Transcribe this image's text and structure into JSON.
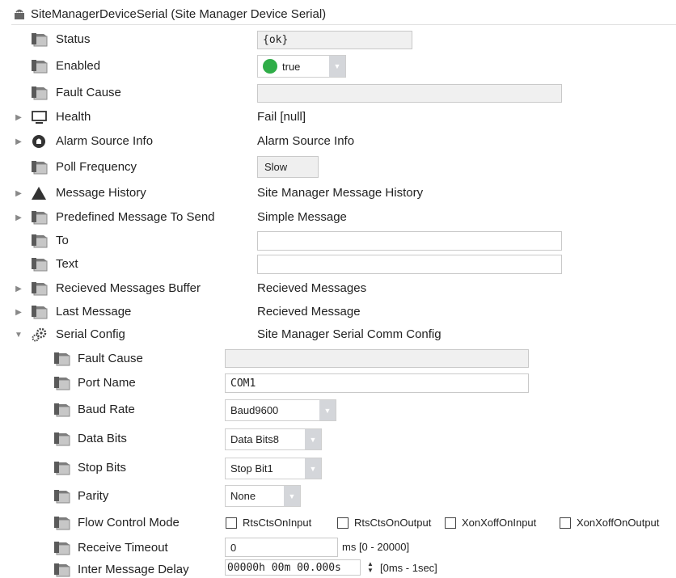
{
  "header": {
    "title": "SiteManagerDeviceSerial  (Site Manager Device Serial)"
  },
  "rows": {
    "status": {
      "label": "Status",
      "value": "{ok}"
    },
    "enabled": {
      "label": "Enabled",
      "value": "true"
    },
    "fault_cause": {
      "label": "Fault Cause",
      "value": ""
    },
    "health": {
      "label": "Health",
      "value": "Fail [null]"
    },
    "alarm_source": {
      "label": "Alarm Source Info",
      "value": "Alarm Source Info"
    },
    "poll_frequency": {
      "label": "Poll Frequency",
      "value": "Slow"
    },
    "message_history": {
      "label": "Message History",
      "value": "Site Manager Message History"
    },
    "predefined_message": {
      "label": "Predefined Message To Send",
      "value": "Simple Message"
    },
    "to": {
      "label": "To",
      "value": ""
    },
    "text": {
      "label": "Text",
      "value": ""
    },
    "received_buffer": {
      "label": "Recieved Messages Buffer",
      "value": "Recieved Messages"
    },
    "last_message": {
      "label": "Last Message",
      "value": "Recieved Message"
    },
    "serial_config": {
      "label": "Serial Config",
      "value": "Site Manager Serial Comm Config"
    }
  },
  "serial": {
    "fault_cause": {
      "label": "Fault Cause",
      "value": ""
    },
    "port_name": {
      "label": "Port Name",
      "value": "COM1"
    },
    "baud_rate": {
      "label": "Baud Rate",
      "value": "Baud9600"
    },
    "data_bits": {
      "label": "Data Bits",
      "value": "Data Bits8"
    },
    "stop_bits": {
      "label": "Stop Bits",
      "value": "Stop Bit1"
    },
    "parity": {
      "label": "Parity",
      "value": "None"
    },
    "flow_control": {
      "label": "Flow Control Mode",
      "options": [
        "RtsCtsOnInput",
        "RtsCtsOnOutput",
        "XonXoffOnInput",
        "XonXoffOnOutput"
      ]
    },
    "receive_timeout": {
      "label": "Receive Timeout",
      "value": "0",
      "range": "ms [0 - 20000]"
    },
    "inter_message_delay": {
      "label": "Inter Message Delay",
      "value": "00000h 00m 00.000s",
      "range": "[0ms - 1sec]"
    }
  },
  "colors": {
    "enabled_dot": "#2fad48",
    "select_arrow": "#d4d6da",
    "field_bg": "#f0f0f0"
  }
}
